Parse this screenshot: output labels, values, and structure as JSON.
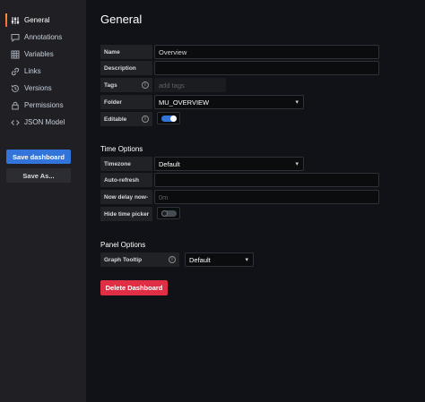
{
  "sidebar": {
    "items": [
      {
        "label": "General",
        "icon": "sliders-icon"
      },
      {
        "label": "Annotations",
        "icon": "comment-icon"
      },
      {
        "label": "Variables",
        "icon": "table-icon"
      },
      {
        "label": "Links",
        "icon": "link-icon"
      },
      {
        "label": "Versions",
        "icon": "history-icon"
      },
      {
        "label": "Permissions",
        "icon": "lock-icon"
      },
      {
        "label": "JSON Model",
        "icon": "code-icon"
      }
    ],
    "save_label": "Save dashboard",
    "save_as_label": "Save As..."
  },
  "main": {
    "title": "General",
    "fields": {
      "name": {
        "label": "Name",
        "value": "Overview"
      },
      "description": {
        "label": "Description",
        "value": ""
      },
      "tags": {
        "label": "Tags",
        "placeholder": "add tags"
      },
      "folder": {
        "label": "Folder",
        "value": "MU_OVERVIEW"
      },
      "editable": {
        "label": "Editable",
        "on": true
      }
    },
    "time_options": {
      "title": "Time Options",
      "timezone": {
        "label": "Timezone",
        "value": "Default"
      },
      "auto_refresh": {
        "label": "Auto-refresh",
        "value": ""
      },
      "now_delay": {
        "label": "Now delay now-",
        "placeholder": "0m"
      },
      "hide_time_picker": {
        "label": "Hide time picker",
        "on": false
      }
    },
    "panel_options": {
      "title": "Panel Options",
      "graph_tooltip": {
        "label": "Graph Tooltip",
        "value": "Default"
      }
    },
    "delete_label": "Delete Dashboard"
  },
  "colors": {
    "primary": "#3274d9",
    "danger": "#e02f44",
    "active_accent": "#ff9830",
    "background": "#111217",
    "sidebar": "#1f1f24"
  }
}
